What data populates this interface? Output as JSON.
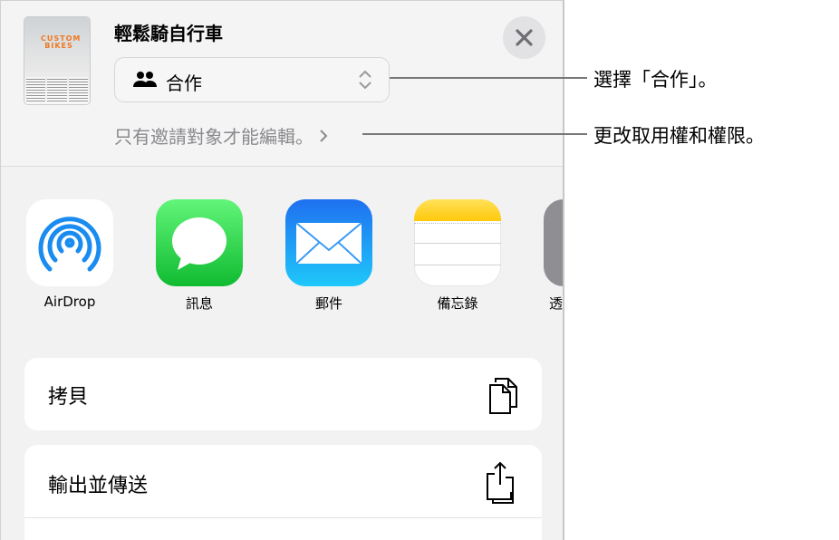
{
  "header": {
    "title": "輕鬆騎自行車",
    "thumbnail_text": "CUSTOM BIKES",
    "collab_select": {
      "value": "合作",
      "icon": "people-icon"
    },
    "access_text": "只有邀請對象才能編輯。",
    "close_icon": "close-icon"
  },
  "apps": [
    {
      "label": "AirDrop",
      "icon": "airdrop-icon"
    },
    {
      "label": "訊息",
      "icon": "messages-icon"
    },
    {
      "label": "郵件",
      "icon": "mail-icon"
    },
    {
      "label": "備忘錄",
      "icon": "notes-icon"
    },
    {
      "label": "透",
      "icon": "more-app-icon"
    }
  ],
  "actions": [
    {
      "label": "拷貝",
      "icon": "copy-icon"
    },
    {
      "label": "輸出並傳送",
      "icon": "share-icon"
    }
  ],
  "callouts": [
    "選擇「合作」。",
    "更改取用權和權限。"
  ],
  "colors": {
    "messages": "#1fc43c",
    "mail": "#1e8cf5",
    "airdrop": "#1a8cf0",
    "notes_yellow": "#ffd02a"
  }
}
